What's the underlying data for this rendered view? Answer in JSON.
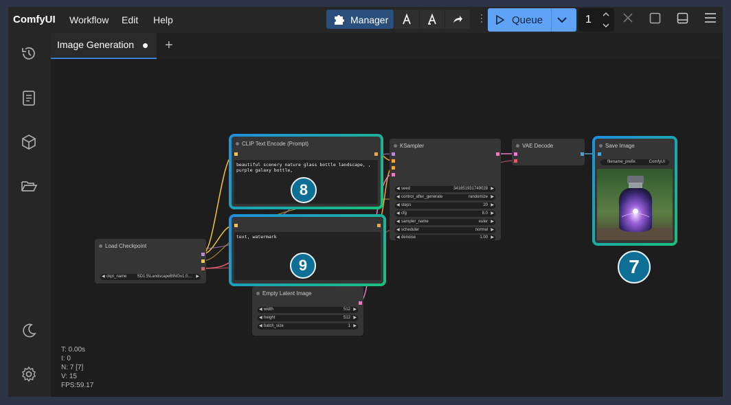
{
  "topbar": {
    "brand": "ComfyUI",
    "menu": [
      "Workflow",
      "Edit",
      "Help"
    ],
    "manager_label": "Manager",
    "queue_label": "Queue",
    "queue_count": "1"
  },
  "tabs": [
    {
      "label": "Image Generation"
    }
  ],
  "stats": [
    "T: 0.00s",
    "I: 0",
    "N: 7 [7]",
    "V: 15",
    "FPS:59.17"
  ],
  "nodes": {
    "load_checkpoint": {
      "title": "Load Checkpoint",
      "widget_label": "ckpt_name",
      "widget_value": "SD1.5\\LandscapeBINGv1.0...."
    },
    "clip_pos": {
      "title": "CLIP Text Encode (Prompt)",
      "text": "beautiful scenery nature glass bottle landscape, , purple galaxy bottle,"
    },
    "clip_neg": {
      "text": "text, watermark"
    },
    "ksampler": {
      "title": "KSampler",
      "widgets": [
        {
          "label": "seed",
          "value": "341651931749028"
        },
        {
          "label": "control_after_generate",
          "value": "randomize"
        },
        {
          "label": "steps",
          "value": "20"
        },
        {
          "label": "cfg",
          "value": "8.0"
        },
        {
          "label": "sampler_name",
          "value": "euler"
        },
        {
          "label": "scheduler",
          "value": "normal"
        },
        {
          "label": "denoise",
          "value": "1.00"
        }
      ]
    },
    "vae_decode": {
      "title": "VAE Decode"
    },
    "save_image": {
      "title": "Save Image",
      "prefix_label": "filename_prefix",
      "prefix_value": "ComfyUI"
    },
    "empty_latent": {
      "title": "Empty Latent Image",
      "widgets": [
        {
          "label": "width",
          "value": "512"
        },
        {
          "label": "height",
          "value": "512"
        },
        {
          "label": "batch_size",
          "value": "1"
        }
      ]
    }
  },
  "badges": {
    "clip_pos": "8",
    "clip_neg": "9",
    "save_image": "7"
  },
  "colors": {
    "accent": "#5ea3f5",
    "highlight_blue": "#1e8fe0",
    "highlight_green": "#19c07a",
    "badge": "#0d6f96"
  }
}
